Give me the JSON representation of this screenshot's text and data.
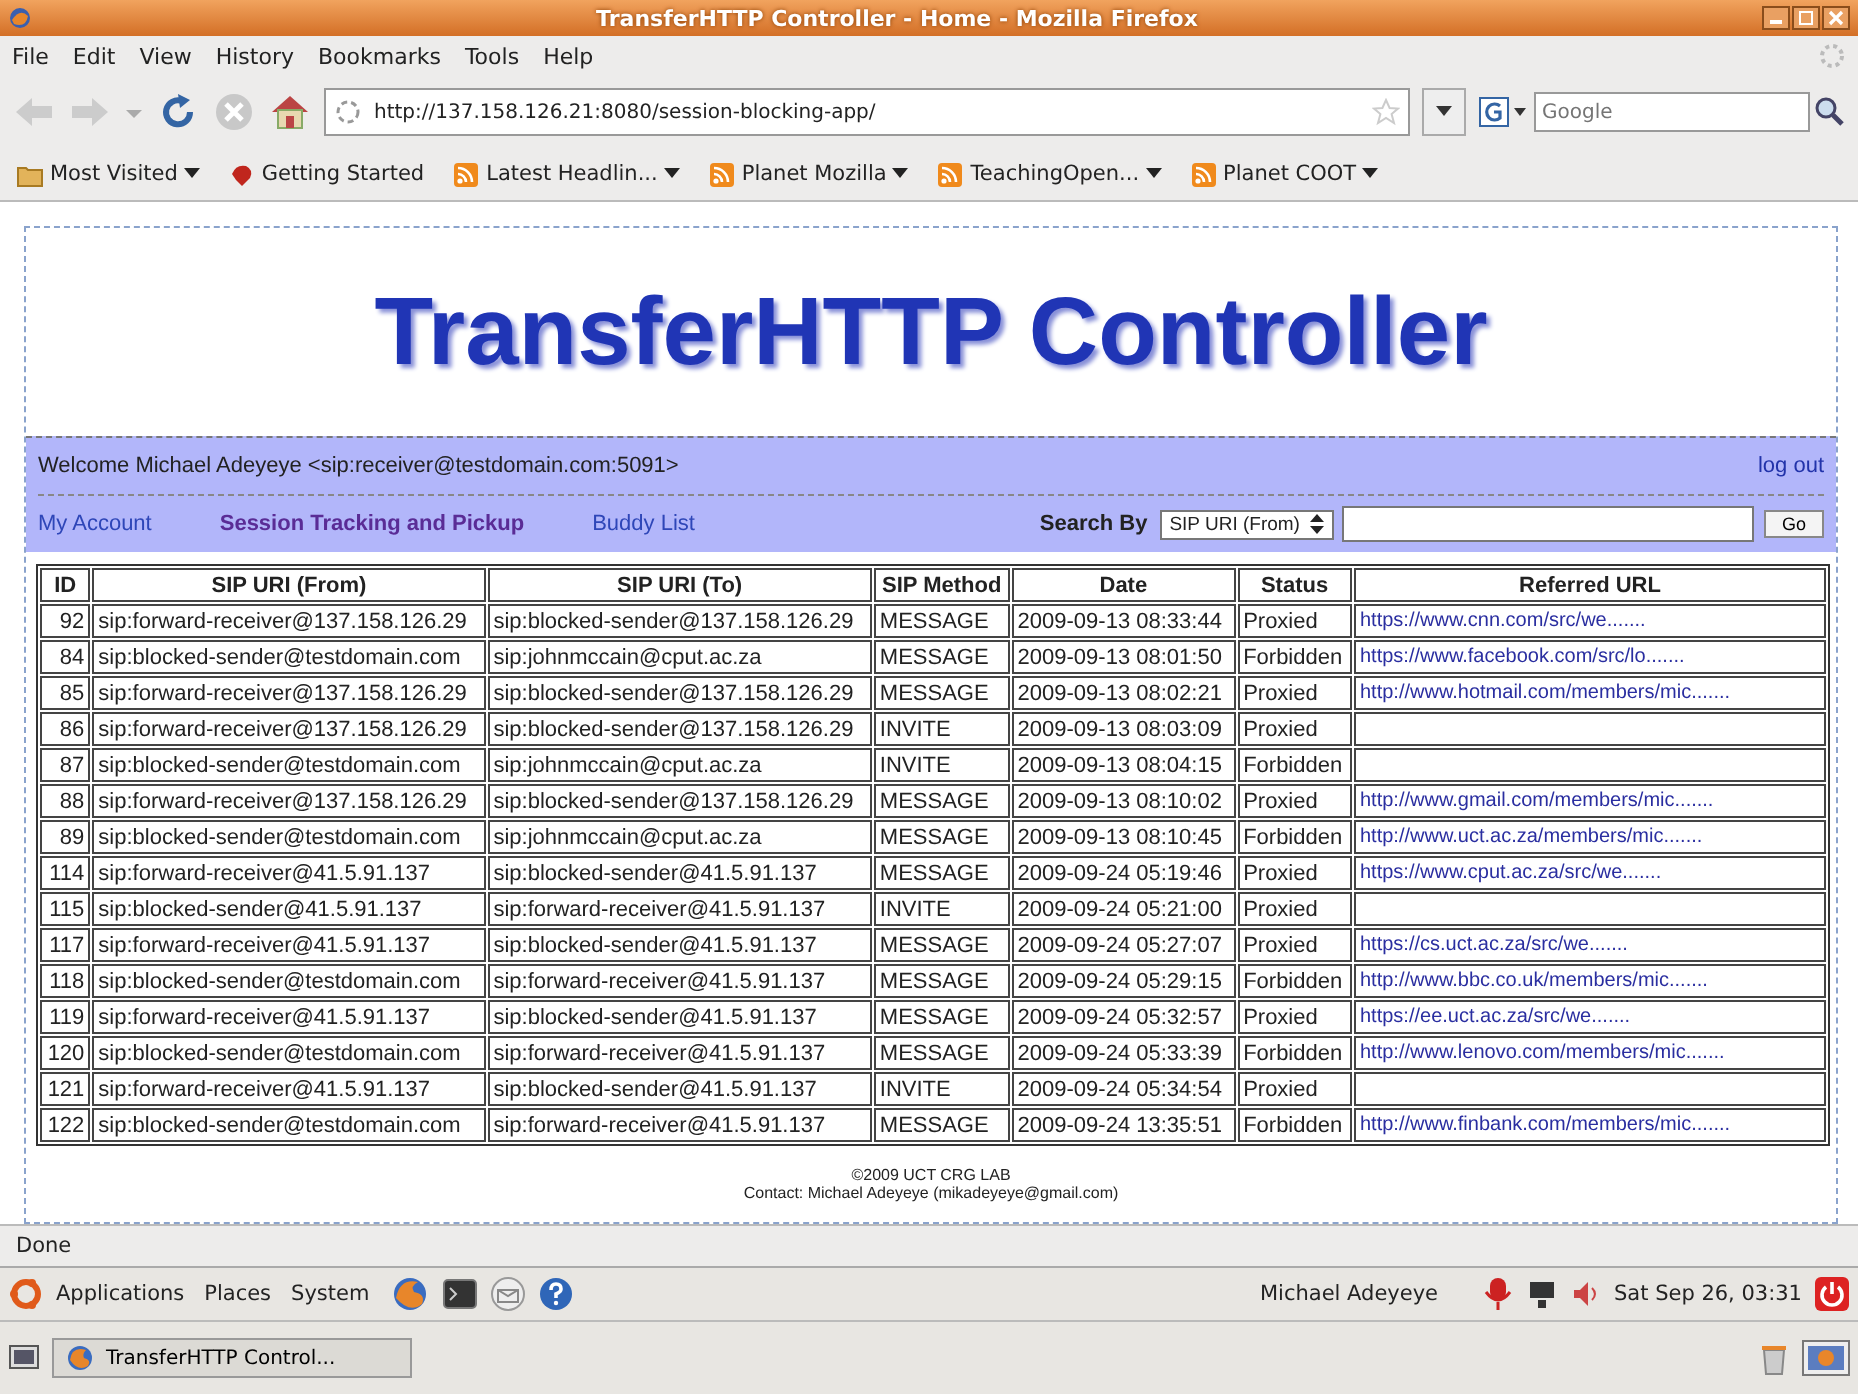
{
  "window": {
    "title": "TransferHTTP Controller - Home - Mozilla Firefox"
  },
  "menu": [
    "File",
    "Edit",
    "View",
    "History",
    "Bookmarks",
    "Tools",
    "Help"
  ],
  "toolbar": {
    "url": "http://137.158.126.21:8080/session-blocking-app/",
    "search_placeholder": "Google"
  },
  "bookmarks": [
    {
      "label": "Most Visited",
      "has_menu": true,
      "kind": "folder"
    },
    {
      "label": "Getting Started",
      "has_menu": false,
      "kind": "page"
    },
    {
      "label": "Latest Headlin...",
      "has_menu": true,
      "kind": "feed"
    },
    {
      "label": "Planet Mozilla",
      "has_menu": true,
      "kind": "feed"
    },
    {
      "label": "TeachingOpen...",
      "has_menu": true,
      "kind": "feed"
    },
    {
      "label": "Planet COOT",
      "has_menu": true,
      "kind": "feed"
    }
  ],
  "page": {
    "heading": "TransferHTTP Controller",
    "welcome": "Welcome Michael Adeyeye <sip:receiver@testdomain.com:5091>",
    "logout": "log out",
    "nav": [
      {
        "label": "My Account",
        "selected": false
      },
      {
        "label": "Session Tracking and Pickup",
        "selected": true
      },
      {
        "label": "Buddy List",
        "selected": false
      }
    ],
    "search": {
      "label": "Search By",
      "select_value": "SIP URI (From)",
      "button": "Go"
    },
    "table": {
      "columns": [
        "ID",
        "SIP URI (From)",
        "SIP URI (To)",
        "SIP Method",
        "Date",
        "Status",
        "Referred URL"
      ],
      "rows": [
        {
          "id": "92",
          "from": "sip:forward-receiver@137.158.126.29",
          "to": "sip:blocked-sender@137.158.126.29",
          "method": "MESSAGE",
          "date": "2009-09-13 08:33:44",
          "status": "Proxied",
          "url": "https://www.cnn.com/src/we......."
        },
        {
          "id": "84",
          "from": "sip:blocked-sender@testdomain.com",
          "to": "sip:johnmccain@cput.ac.za",
          "method": "MESSAGE",
          "date": "2009-09-13 08:01:50",
          "status": "Forbidden",
          "url": "https://www.facebook.com/src/lo......."
        },
        {
          "id": "85",
          "from": "sip:forward-receiver@137.158.126.29",
          "to": "sip:blocked-sender@137.158.126.29",
          "method": "MESSAGE",
          "date": "2009-09-13 08:02:21",
          "status": "Proxied",
          "url": "http://www.hotmail.com/members/mic......."
        },
        {
          "id": "86",
          "from": "sip:forward-receiver@137.158.126.29",
          "to": "sip:blocked-sender@137.158.126.29",
          "method": "INVITE",
          "date": "2009-09-13 08:03:09",
          "status": "Proxied"
        },
        {
          "id": "87",
          "from": "sip:blocked-sender@testdomain.com",
          "to": "sip:johnmccain@cput.ac.za",
          "method": "INVITE",
          "date": "2009-09-13 08:04:15",
          "status": "Forbidden"
        },
        {
          "id": "88",
          "from": "sip:forward-receiver@137.158.126.29",
          "to": "sip:blocked-sender@137.158.126.29",
          "method": "MESSAGE",
          "date": "2009-09-13 08:10:02",
          "status": "Proxied",
          "url": "http://www.gmail.com/members/mic......."
        },
        {
          "id": "89",
          "from": "sip:blocked-sender@testdomain.com",
          "to": "sip:johnmccain@cput.ac.za",
          "method": "MESSAGE",
          "date": "2009-09-13 08:10:45",
          "status": "Forbidden",
          "url": "http://www.uct.ac.za/members/mic......."
        },
        {
          "id": "114",
          "from": "sip:forward-receiver@41.5.91.137",
          "to": "sip:blocked-sender@41.5.91.137",
          "method": "MESSAGE",
          "date": "2009-09-24 05:19:46",
          "status": "Proxied",
          "url": "https://www.cput.ac.za/src/we......."
        },
        {
          "id": "115",
          "from": "sip:blocked-sender@41.5.91.137",
          "to": "sip:forward-receiver@41.5.91.137",
          "method": "INVITE",
          "date": "2009-09-24 05:21:00",
          "status": "Proxied"
        },
        {
          "id": "117",
          "from": "sip:forward-receiver@41.5.91.137",
          "to": "sip:blocked-sender@41.5.91.137",
          "method": "MESSAGE",
          "date": "2009-09-24 05:27:07",
          "status": "Proxied",
          "url": "https://cs.uct.ac.za/src/we......."
        },
        {
          "id": "118",
          "from": "sip:blocked-sender@testdomain.com",
          "to": "sip:forward-receiver@41.5.91.137",
          "method": "MESSAGE",
          "date": "2009-09-24 05:29:15",
          "status": "Forbidden",
          "url": "http://www.bbc.co.uk/members/mic......."
        },
        {
          "id": "119",
          "from": "sip:forward-receiver@41.5.91.137",
          "to": "sip:blocked-sender@41.5.91.137",
          "method": "MESSAGE",
          "date": "2009-09-24 05:32:57",
          "status": "Proxied",
          "url": "https://ee.uct.ac.za/src/we......."
        },
        {
          "id": "120",
          "from": "sip:blocked-sender@testdomain.com",
          "to": "sip:forward-receiver@41.5.91.137",
          "method": "MESSAGE",
          "date": "2009-09-24 05:33:39",
          "status": "Forbidden",
          "url": "http://www.lenovo.com/members/mic......."
        },
        {
          "id": "121",
          "from": "sip:forward-receiver@41.5.91.137",
          "to": "sip:blocked-sender@41.5.91.137",
          "method": "INVITE",
          "date": "2009-09-24 05:34:54",
          "status": "Proxied"
        },
        {
          "id": "122",
          "from": "sip:blocked-sender@testdomain.com",
          "to": "sip:forward-receiver@41.5.91.137",
          "method": "MESSAGE",
          "date": "2009-09-24 13:35:51",
          "status": "Forbidden",
          "url": "http://www.finbank.com/members/mic......."
        }
      ]
    },
    "footer": [
      "©2009 UCT CRG LAB",
      "Contact: Michael Adeyeye (mikadeyeye@gmail.com)"
    ]
  },
  "status_bar": "Done",
  "panel": {
    "menus": [
      "Applications",
      "Places",
      "System"
    ],
    "user": "Michael Adeyeye",
    "clock": "Sat Sep 26, 03:31"
  },
  "taskbar": [
    {
      "label": "TransferHTTP Control..."
    }
  ]
}
